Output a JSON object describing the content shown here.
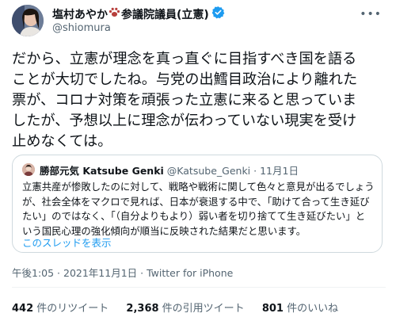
{
  "author": {
    "name": "塩村あやか",
    "title_suffix": "参議院議員(立憲)",
    "handle": "@shiomura"
  },
  "tweet": {
    "lines": [
      "だから、立憲が理念を真っ直ぐに目指すべき国を語る",
      "ことが大切でしたね。与党の出鱈目政治により離れた",
      "票が、コロナ対策を頑張った立憲に来ると思っていま",
      "したが、予想以上に理念が伝わっていない現実を受け",
      "止めなくては。"
    ]
  },
  "quote": {
    "name": "勝部元気 Katsube Genki",
    "handle": "@Katsube_Genki",
    "dot": "·",
    "date": "11月1日",
    "lines": [
      "立憲共産が惨敗したのに対して、戦略や戦術に関して色々と意見が出るでしょう",
      "が、社会全体をマクロで見れば、日本が衰退する中で、「助けて合って生き延び",
      "たい」のではなく、「（自分よりもより）弱い者を切り捨てて生き延びたい」と",
      "いう国民心理の強化傾向が順当に反映された結果だと思います。"
    ],
    "thread_link": "このスレッドを表示"
  },
  "meta": {
    "timestamp": "午後1:05 · 2021年11月1日 · ",
    "source": "Twitter for iPhone"
  },
  "stats": {
    "retweets_count": "442",
    "retweets_label": " 件のリツイート",
    "quotes_count": "2,368",
    "quotes_label": " 件の引用ツイート",
    "likes_count": "801",
    "likes_label": " 件のいいね"
  },
  "colors": {
    "link": "#1d9bf0",
    "verified": "#1d9bf0",
    "muted": "#536471",
    "border": "#cfd9de"
  },
  "icons": {
    "paw": "paw-icon",
    "verified": "verified-badge-icon",
    "more": "more-options-icon"
  }
}
